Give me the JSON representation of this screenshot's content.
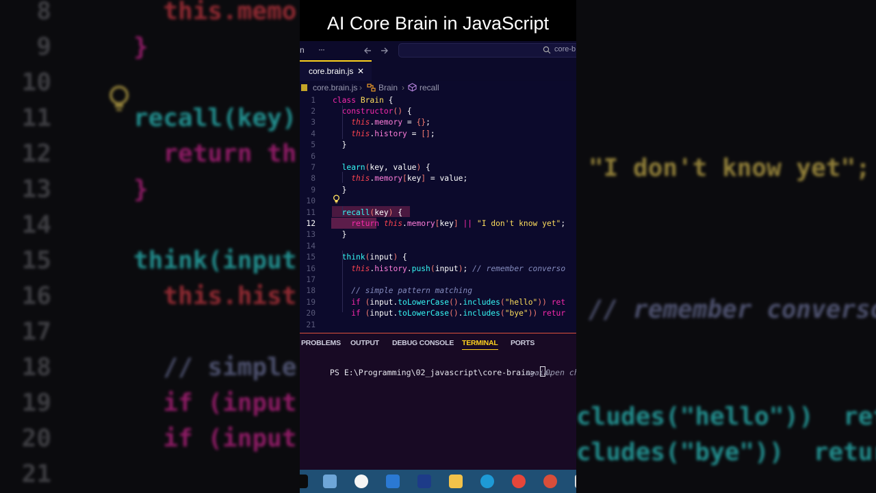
{
  "video": {
    "title": "AI Core Brain in JavaScript"
  },
  "topbar": {
    "left_text": "n",
    "more": "···",
    "search_placeholder": "core-b"
  },
  "tab": {
    "filename": "core.brain.js",
    "close": "✕"
  },
  "breadcrumb": {
    "file": "core.brain.js",
    "class_name": "Brain",
    "method": "recall",
    "sep": "›"
  },
  "editor": {
    "line_numbers": [
      "1",
      "2",
      "3",
      "4",
      "5",
      "6",
      "7",
      "8",
      "9",
      "10",
      "11",
      "12",
      "13",
      "14",
      "15",
      "16",
      "17",
      "18",
      "19",
      "20",
      "21"
    ],
    "current_line": "12",
    "lines": [
      [
        [
          "k-pink",
          "class "
        ],
        [
          "k-cls",
          "Brain"
        ],
        [
          "k-white",
          " {"
        ]
      ],
      [
        [
          "k-pink",
          "  constructor"
        ],
        [
          "k-paren",
          "()"
        ],
        [
          "k-white",
          " {"
        ]
      ],
      [
        [
          "k-this",
          "    this"
        ],
        [
          "k-white",
          "."
        ],
        [
          "k-prop",
          "memory"
        ],
        [
          "k-white",
          " = "
        ],
        [
          "k-paren",
          "{}"
        ],
        [
          "k-white",
          ";"
        ]
      ],
      [
        [
          "k-this",
          "    this"
        ],
        [
          "k-white",
          "."
        ],
        [
          "k-prop",
          "history"
        ],
        [
          "k-white",
          " = "
        ],
        [
          "k-paren",
          "[]"
        ],
        [
          "k-white",
          ";"
        ]
      ],
      [
        [
          "k-white",
          "  }"
        ]
      ],
      [],
      [
        [
          "k-fn",
          "  learn"
        ],
        [
          "k-paren",
          "("
        ],
        [
          "k-white",
          "key, value"
        ],
        [
          "k-paren",
          ")"
        ],
        [
          "k-white",
          " {"
        ]
      ],
      [
        [
          "k-this",
          "    this"
        ],
        [
          "k-white",
          "."
        ],
        [
          "k-prop",
          "memory"
        ],
        [
          "k-paren",
          "["
        ],
        [
          "k-white",
          "key"
        ],
        [
          "k-paren",
          "]"
        ],
        [
          "k-white",
          " = value;"
        ]
      ],
      [
        [
          "k-white",
          "  }"
        ]
      ],
      [],
      [
        [
          "k-fn",
          "  recall"
        ],
        [
          "k-paren",
          "("
        ],
        [
          "k-white",
          "key"
        ],
        [
          "k-paren",
          ")"
        ],
        [
          "k-white",
          " {"
        ]
      ],
      [
        [
          "k-pink",
          "    return "
        ],
        [
          "k-this",
          "this"
        ],
        [
          "k-white",
          "."
        ],
        [
          "k-prop",
          "memory"
        ],
        [
          "k-paren",
          "["
        ],
        [
          "k-white",
          "key"
        ],
        [
          "k-paren",
          "]"
        ],
        [
          "k-pink",
          " || "
        ],
        [
          "k-yel",
          "\"I don't know yet\""
        ],
        [
          "k-white",
          ";"
        ]
      ],
      [
        [
          "k-white",
          "  }"
        ]
      ],
      [],
      [
        [
          "k-fn",
          "  think"
        ],
        [
          "k-paren",
          "("
        ],
        [
          "k-white",
          "input"
        ],
        [
          "k-paren",
          ")"
        ],
        [
          "k-white",
          " {"
        ]
      ],
      [
        [
          "k-this",
          "    this"
        ],
        [
          "k-white",
          "."
        ],
        [
          "k-prop",
          "history"
        ],
        [
          "k-white",
          "."
        ],
        [
          "k-fn",
          "push"
        ],
        [
          "k-paren",
          "("
        ],
        [
          "k-white",
          "input"
        ],
        [
          "k-paren",
          ")"
        ],
        [
          "k-white",
          "; "
        ],
        [
          "k-cmt",
          "// remember converso"
        ]
      ],
      [],
      [
        [
          "k-cmt",
          "    // simple pattern matching"
        ]
      ],
      [
        [
          "k-pink",
          "    if "
        ],
        [
          "k-paren",
          "("
        ],
        [
          "k-white",
          "input."
        ],
        [
          "k-fn",
          "toLowerCase"
        ],
        [
          "k-paren",
          "()"
        ],
        [
          "k-white",
          "."
        ],
        [
          "k-fn",
          "includes"
        ],
        [
          "k-paren",
          "("
        ],
        [
          "k-yel",
          "\"hello\""
        ],
        [
          "k-paren",
          "))"
        ],
        [
          "k-pink",
          " ret"
        ]
      ],
      [
        [
          "k-pink",
          "    if "
        ],
        [
          "k-paren",
          "("
        ],
        [
          "k-white",
          "input."
        ],
        [
          "k-fn",
          "toLowerCase"
        ],
        [
          "k-paren",
          "()"
        ],
        [
          "k-white",
          "."
        ],
        [
          "k-fn",
          "includes"
        ],
        [
          "k-paren",
          "("
        ],
        [
          "k-yel",
          "\"bye\""
        ],
        [
          "k-paren",
          "))"
        ],
        [
          "k-pink",
          " retur"
        ]
      ],
      []
    ]
  },
  "panel": {
    "tabs": [
      "PROBLEMS",
      "OUTPUT",
      "DEBUG CONSOLE",
      "TERMINAL",
      "PORTS"
    ],
    "active_tab": "TERMINAL",
    "prompt": "PS E:\\Programming\\02_javascript\\core-brain> ",
    "ghost_text": "Open chat ",
    "ghost_text_2": "again."
  },
  "background": {
    "line_numbers": [
      "8",
      "9",
      "10",
      "11",
      "12",
      "13",
      "14",
      "15",
      "16",
      "17",
      "18",
      "19",
      "20",
      "21"
    ],
    "rows": [
      "  this.memo",
      "}",
      "",
      "recall(key)",
      "  return th",
      "}",
      "",
      "think(input",
      "  this.hist",
      "",
      "  // simple",
      "  if (input",
      "  if (input",
      ""
    ],
    "right_rows": {
      "r12": "\"I don't know yet\";",
      "r16": "// remember converso",
      "r19": "cludes(\"hello\"))  ret",
      "r20": "cludes(\"bye\"))  retur"
    },
    "colors": {
      "yellow": "#fede5d",
      "pink": "#f92aad",
      "cyan": "#36f9f6",
      "comment": "#848bbd"
    }
  },
  "taskbar": {
    "icons": [
      "start-icon",
      "pc-icon",
      "linux-tux-icon",
      "store-icon",
      "security-icon",
      "file-explorer-icon",
      "edge-icon",
      "chrome-icon",
      "chrome-profile-icon",
      "overflow-icon"
    ]
  }
}
